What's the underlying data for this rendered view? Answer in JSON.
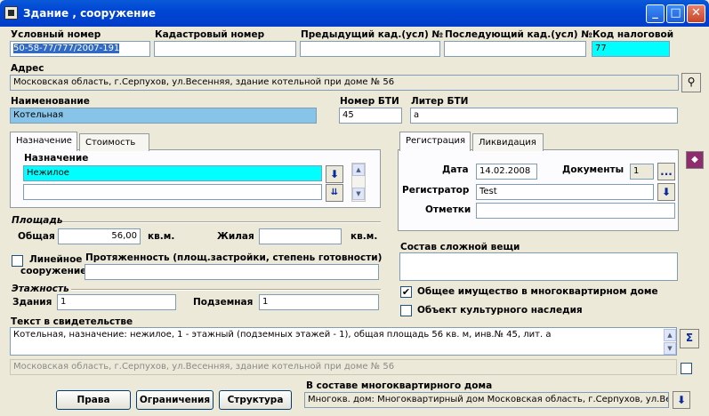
{
  "window": {
    "title": "Здание , сооружение"
  },
  "top_fields": {
    "uslovny_label": "Условный номер",
    "uslovny_value": "50-58-77/777/2007-191",
    "kadastr_label": "Кадастровый номер",
    "kadastr_value": "",
    "prev_label": "Предыдущий кад.(усл) №",
    "prev_value": "",
    "next_label": "Последующий кад.(усл) №",
    "next_value": "",
    "tax_label": "Код налоговой",
    "tax_value": "77"
  },
  "address": {
    "label": "Адрес",
    "value": "Московская область, г.Серпухов, ул.Весенняя, здание котельной при доме № 56"
  },
  "name": {
    "label": "Наименование",
    "value": "Котельная"
  },
  "bti": {
    "number_label": "Номер БТИ",
    "number_value": "45",
    "liter_label": "Литер БТИ",
    "liter_value": "а"
  },
  "left_tabs": {
    "tabs": [
      "Назначение",
      "Стоимость"
    ],
    "purpose_label": "Назначение",
    "purpose_value": "Нежилое",
    "purpose_value2": ""
  },
  "right_tabs": {
    "tabs": [
      "Регистрация",
      "Ликвидация"
    ],
    "date_label": "Дата",
    "date_value": "14.02.2008",
    "docs_label": "Документы",
    "docs_value": "1",
    "docs_button": "...",
    "registrar_label": "Регистратор",
    "registrar_value": "Test",
    "notes_label": "Отметки",
    "notes_value": ""
  },
  "area": {
    "section_label": "Площадь",
    "total_label": "Общая",
    "total_value": "56,00",
    "total_unit": "кв.м.",
    "living_label": "Жилая",
    "living_value": "",
    "living_unit": "кв.м."
  },
  "linear": {
    "checkbox_label_1": "Линейное",
    "checkbox_label_2": "сооружение",
    "extent_label": "Протяженность (площ.застройки, степень готовности)",
    "extent_value": ""
  },
  "complex": {
    "label": "Состав сложной вещи",
    "value": ""
  },
  "floors": {
    "section_label": "Этажность",
    "building_label": "Здания",
    "building_value": "1",
    "under_label": "Подземная",
    "under_value": "1"
  },
  "checks": {
    "common_property": "Общее имущество в многоквартирном доме",
    "common_property_checked": "✔",
    "cultural": "Объект культурного наследия"
  },
  "certificate": {
    "label": "Текст в свидетельстве",
    "text": "Котельная, назначение: нежилое, 1 - этажный (подземных этажей - 1), общая площадь 56 кв. м, инв.№ 45, лит. а",
    "address_line": "Московская область, г.Серпухов, ул.Весенняя, здание котельной при доме № 56"
  },
  "buttons": {
    "rights": "Права",
    "restrictions": "Ограничения",
    "structure": "Структура"
  },
  "apartment": {
    "label": "В составе многоквартирного дома",
    "value": "Многокв. дом: Многоквартирный дом Московская область, г.Серпухов, ул.Весе"
  },
  "colors": {
    "title_bar": "#0046D5",
    "selection": "#316AC5",
    "cyan_field": "#00FFFF",
    "name_field": "#87C4E8"
  }
}
